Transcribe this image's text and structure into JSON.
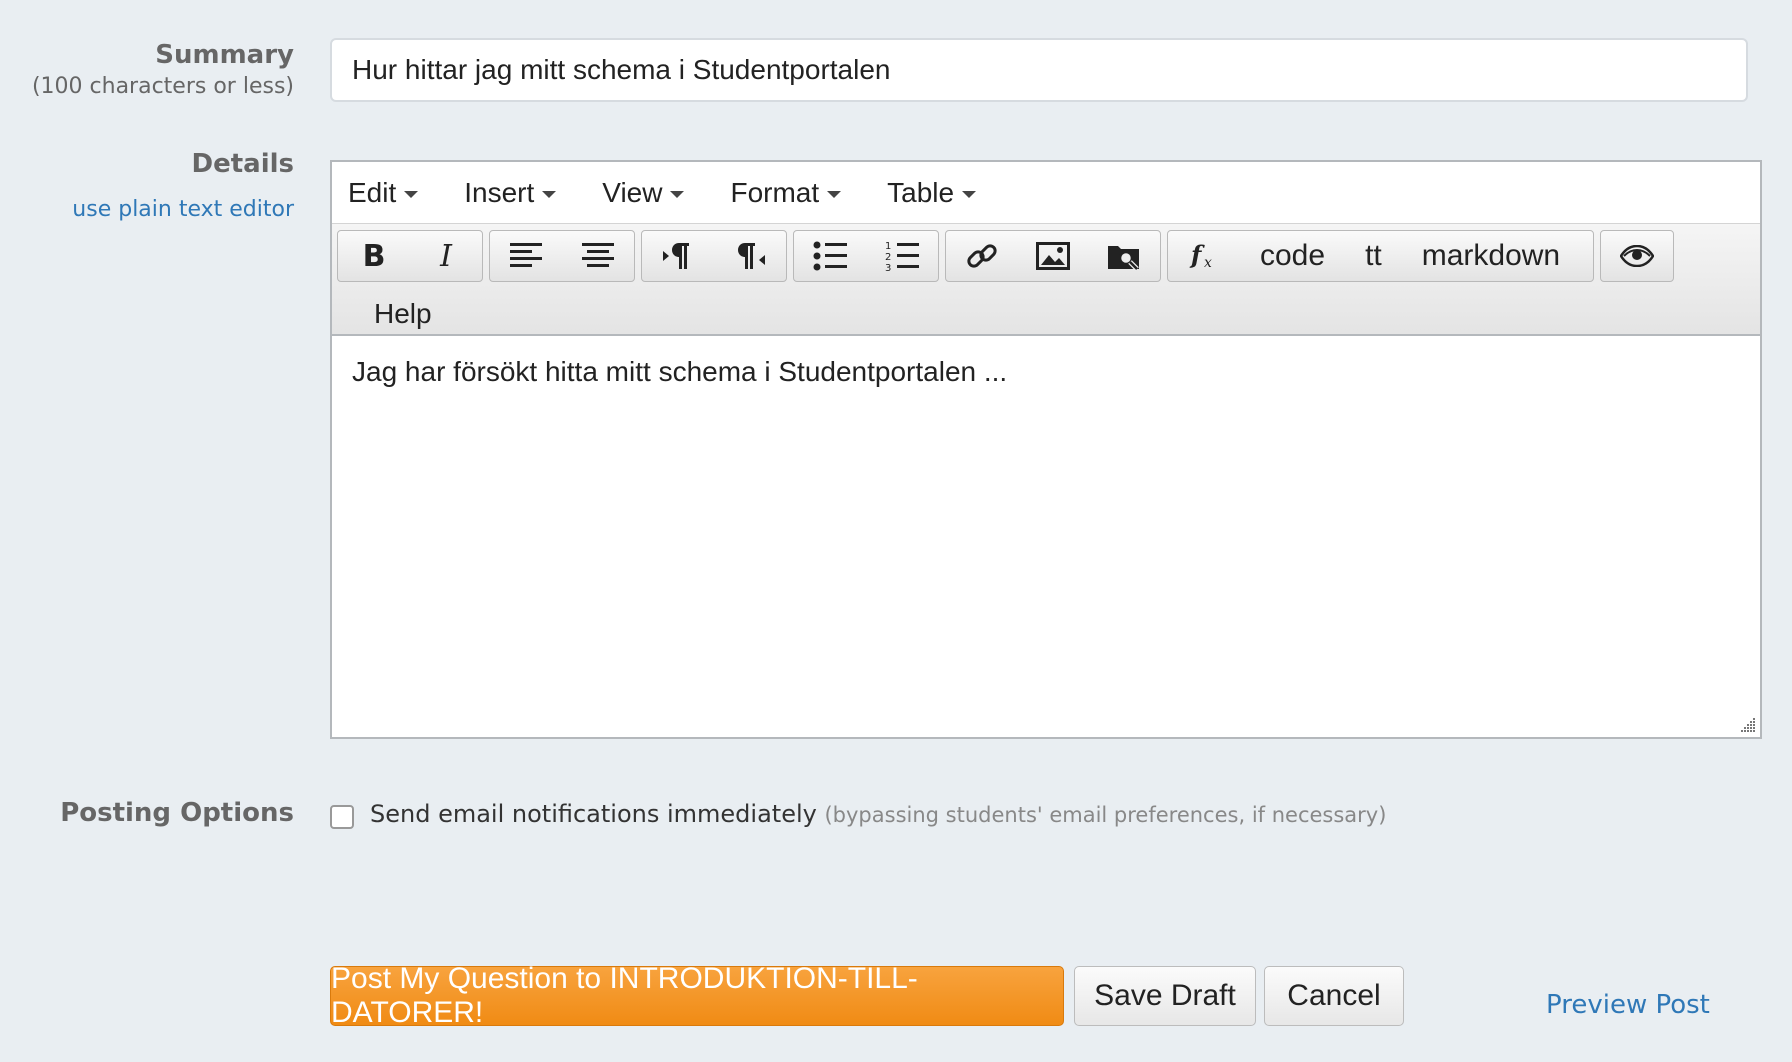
{
  "summary": {
    "label": "Summary",
    "hint": "(100 characters or less)",
    "value": "Hur hittar jag mitt schema i Studentportalen"
  },
  "details": {
    "label": "Details",
    "plain_link": "use plain text editor"
  },
  "editor": {
    "menus": [
      "Edit",
      "Insert",
      "View",
      "Format",
      "Table"
    ],
    "toolbar": {
      "bold": "B",
      "italic": "I",
      "code": "code",
      "tt": "tt",
      "markdown": "markdown",
      "help": "Help"
    },
    "body": "Jag har försökt hitta mitt schema i Studentportalen ..."
  },
  "posting": {
    "label": "Posting Options",
    "notify_text": "Send email notifications immediately",
    "notify_hint": "(bypassing students' email preferences, if necessary)",
    "notify_checked": false
  },
  "actions": {
    "post": "Post My Question to INTRODUKTION-TILL-DATORER!",
    "save_draft": "Save Draft",
    "cancel": "Cancel",
    "preview": "Preview Post"
  },
  "colors": {
    "accent": "#f29a2e",
    "link": "#2f78b7",
    "background": "#e9eef2"
  }
}
